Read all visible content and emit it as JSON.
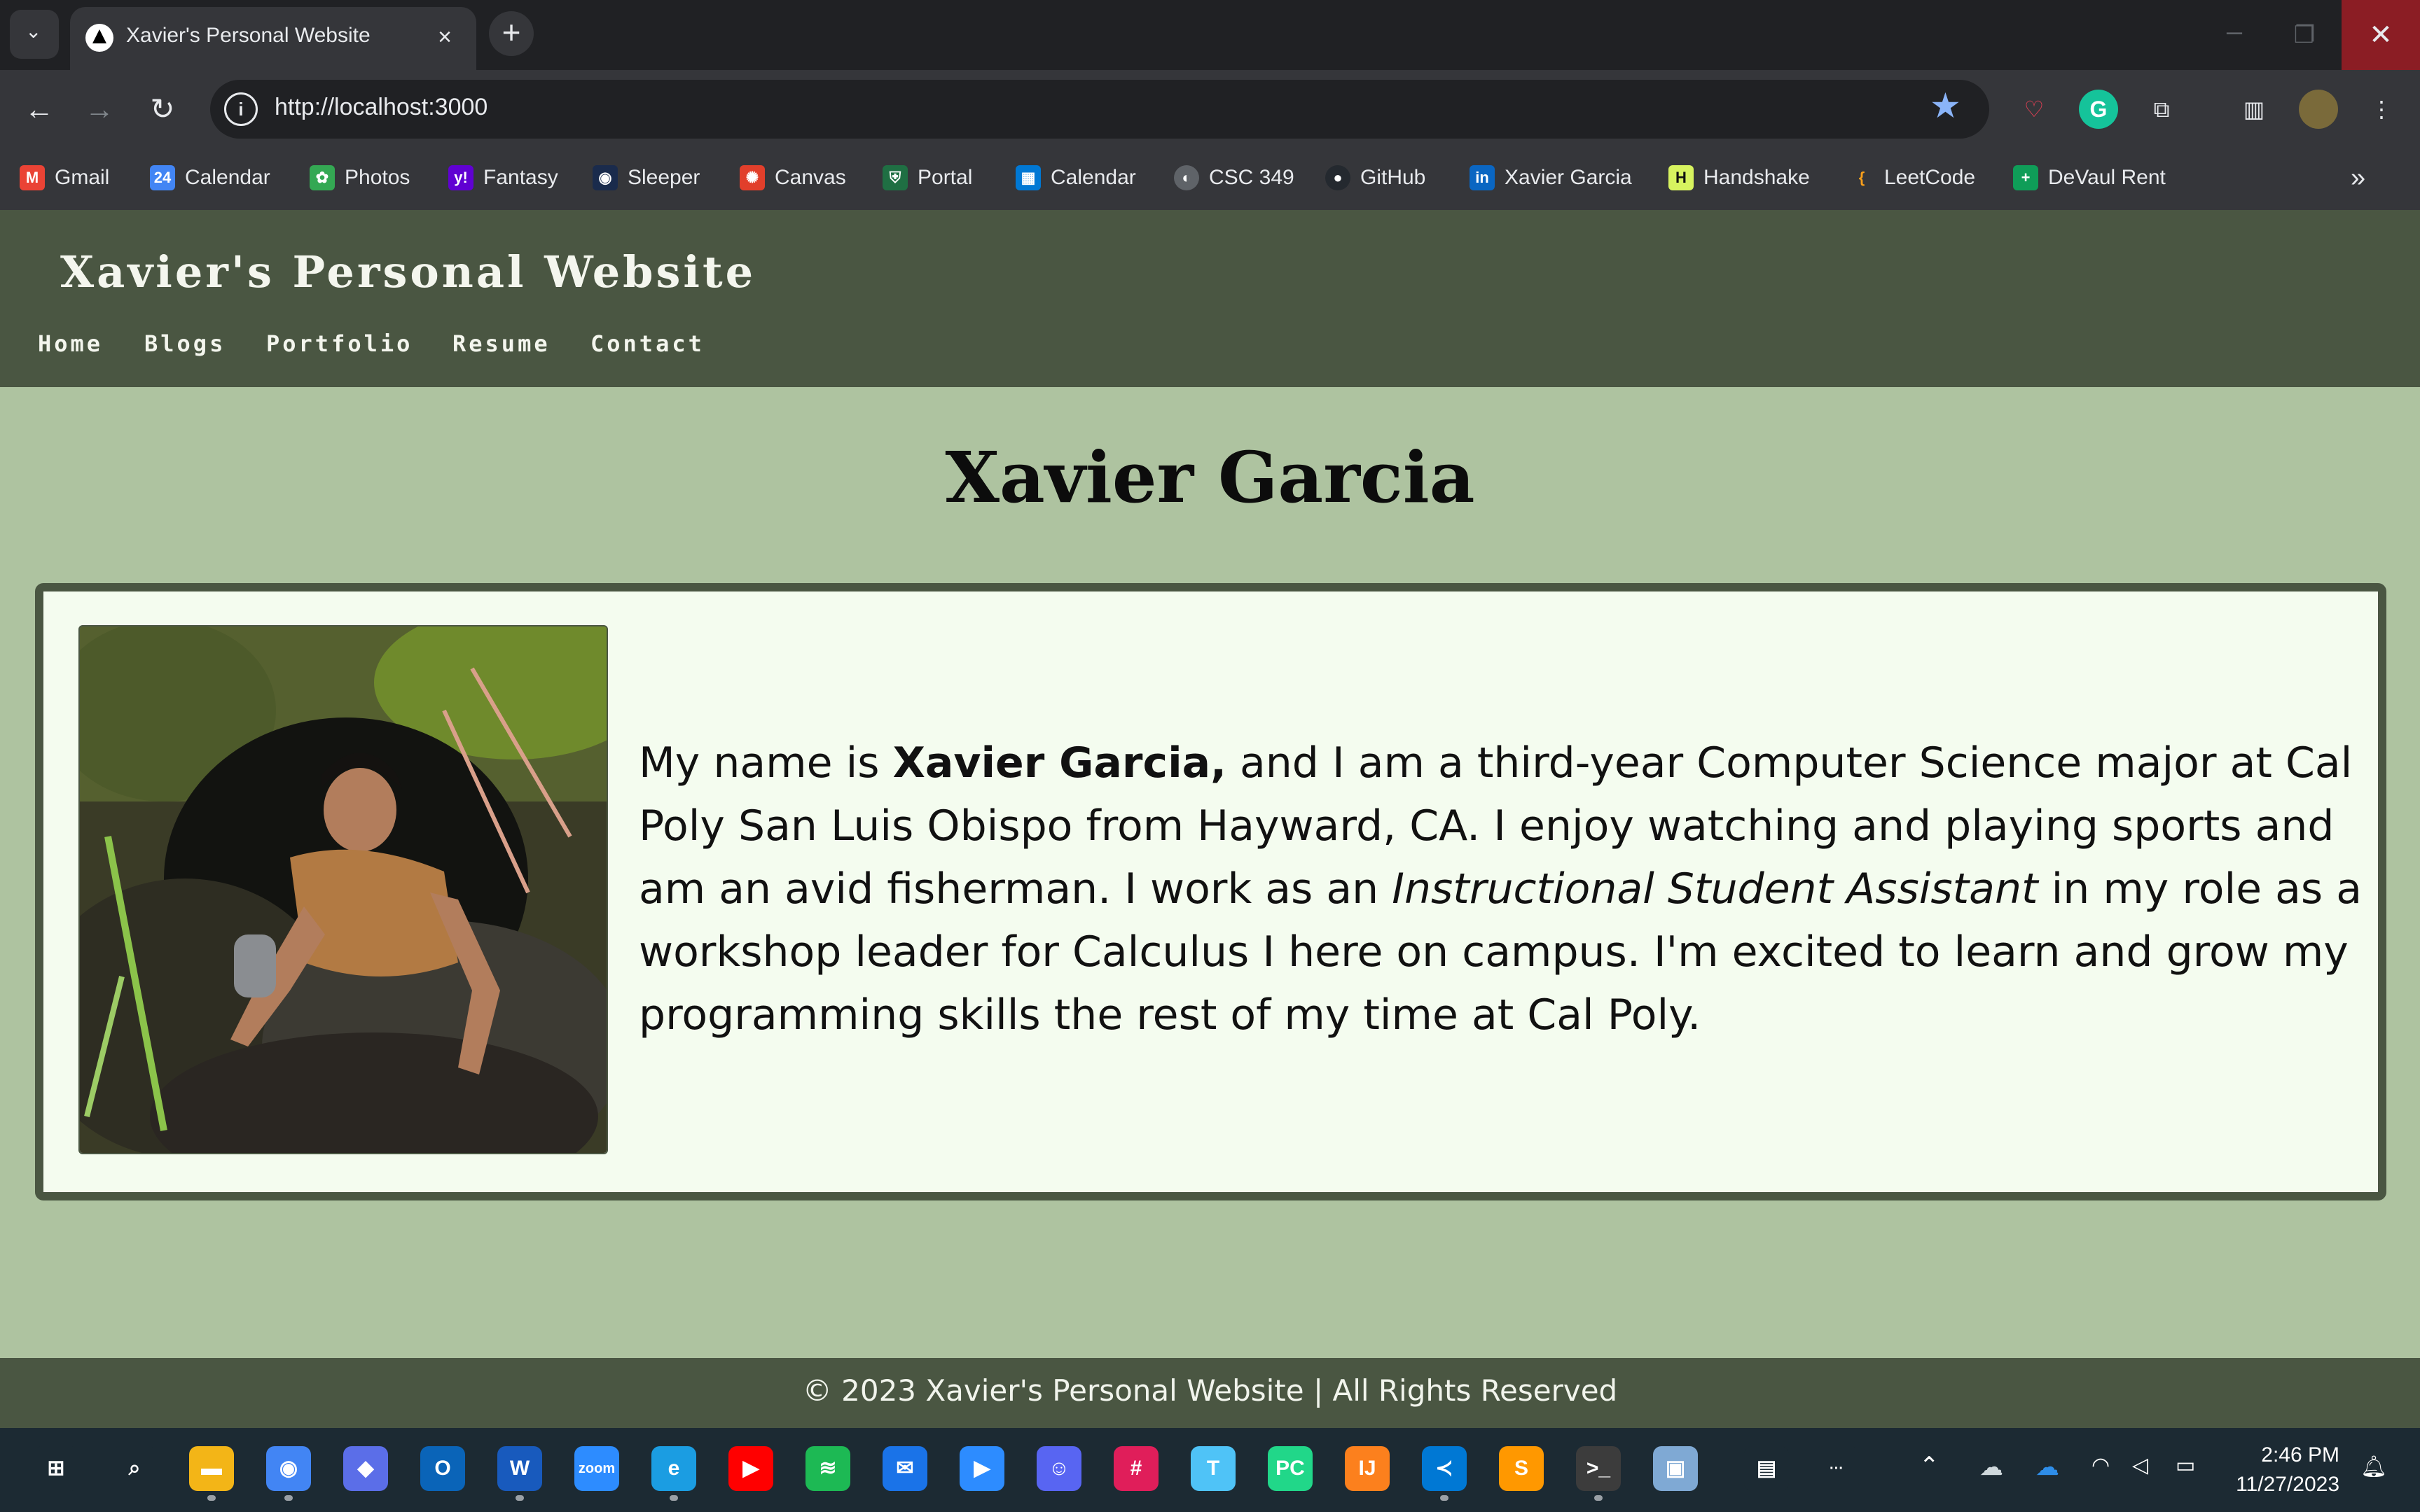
{
  "browser": {
    "tab_title": "Xavier's Personal Website",
    "url": "http://localhost:3000",
    "bookmarks": [
      {
        "label": "Gmail",
        "color": "#ea4335",
        "glyph": "M"
      },
      {
        "label": "Calendar",
        "color": "#4285f4",
        "glyph": "24"
      },
      {
        "label": "Photos",
        "color": "#fbbc04",
        "glyph": "✿"
      },
      {
        "label": "Fantasy",
        "color": "#6001d2",
        "glyph": "y!"
      },
      {
        "label": "Sleeper",
        "color": "#1a2b4c",
        "glyph": "◉"
      },
      {
        "label": "Canvas",
        "color": "#e13f2b",
        "glyph": "✺"
      },
      {
        "label": "Portal",
        "color": "#1f6f43",
        "glyph": "⛨"
      },
      {
        "label": "Calendar",
        "color": "#0078d4",
        "glyph": "▦"
      },
      {
        "label": "CSC 349",
        "color": "#5f6368",
        "glyph": "◐"
      },
      {
        "label": "GitHub",
        "color": "#24292f",
        "glyph": "●"
      },
      {
        "label": "Xavier Garcia",
        "color": "#0a66c2",
        "glyph": "in"
      },
      {
        "label": "Handshake",
        "color": "#d7f35f",
        "glyph": "H"
      },
      {
        "label": "LeetCode",
        "color": "#f89f1b",
        "glyph": "{"
      },
      {
        "label": "DeVaul Rent",
        "color": "#0f9d58",
        "glyph": "+"
      }
    ]
  },
  "site": {
    "title": "Xavier's Personal Website",
    "nav": [
      "Home",
      "Blogs",
      "Portfolio",
      "Resume",
      "Contact"
    ],
    "heading": "Xavier Garcia",
    "bio": {
      "part1": "My name is ",
      "name_bold": "Xavier Garcia,",
      "part2": " and I am a third-year Computer Science major at Cal Poly San Luis Obispo from Hayward, CA. I enjoy watching and playing sports and am an avid fisherman. I work as an ",
      "role_italic": "Instructional Student Assistant",
      "part3": " in my role as a workshop leader for Calculus I here on campus. I'm excited to learn and grow my programming skills the rest of my time at Cal Poly."
    },
    "footer": "© 2023 Xavier's Personal Website | All Rights Reserved"
  },
  "colors": {
    "header_bg": "#4a5642",
    "page_bg": "#aec3a0",
    "card_bg": "#f4fcef"
  },
  "taskbar": {
    "time": "2:46 PM",
    "date": "11/27/2023",
    "apps": [
      {
        "name": "start",
        "color": "#1c2a33",
        "glyph": "⊞"
      },
      {
        "name": "search",
        "color": "#1c2a33",
        "glyph": "⌕"
      },
      {
        "name": "file-explorer",
        "color": "#f3b517",
        "glyph": "▬"
      },
      {
        "name": "chrome",
        "color": "#4285f4",
        "glyph": "◉"
      },
      {
        "name": "copilot",
        "color": "#5b6ee8",
        "glyph": "◆"
      },
      {
        "name": "outlook",
        "color": "#0a64b8",
        "glyph": "O"
      },
      {
        "name": "word",
        "color": "#185abd",
        "glyph": "W"
      },
      {
        "name": "zoom",
        "color": "#2d8cff",
        "glyph": "zoom"
      },
      {
        "name": "edge",
        "color": "#1b9de2",
        "glyph": "e"
      },
      {
        "name": "youtube",
        "color": "#ff0000",
        "glyph": "▶"
      },
      {
        "name": "spotify",
        "color": "#1db954",
        "glyph": "≋"
      },
      {
        "name": "messages",
        "color": "#1a73e8",
        "glyph": "✉"
      },
      {
        "name": "zoom-meetings",
        "color": "#2d8cff",
        "glyph": "▶"
      },
      {
        "name": "discord",
        "color": "#5865f2",
        "glyph": "☺"
      },
      {
        "name": "slack",
        "color": "#e01e5a",
        "glyph": "#"
      },
      {
        "name": "teams",
        "color": "#4fc3f7",
        "glyph": "T"
      },
      {
        "name": "pycharm",
        "color": "#21d789",
        "glyph": "PC"
      },
      {
        "name": "intellij",
        "color": "#fc801d",
        "glyph": "IJ"
      },
      {
        "name": "vscode",
        "color": "#0078d4",
        "glyph": "≺"
      },
      {
        "name": "sublime",
        "color": "#ff9800",
        "glyph": "S"
      },
      {
        "name": "terminal",
        "color": "#3c3c3c",
        "glyph": ">_"
      },
      {
        "name": "virtualbox",
        "color": "#7fa9d4",
        "glyph": "▣"
      },
      {
        "name": "remote",
        "color": "#1c2a33",
        "glyph": "▤"
      },
      {
        "name": "more",
        "color": "#1c2a33",
        "glyph": "···"
      }
    ]
  }
}
